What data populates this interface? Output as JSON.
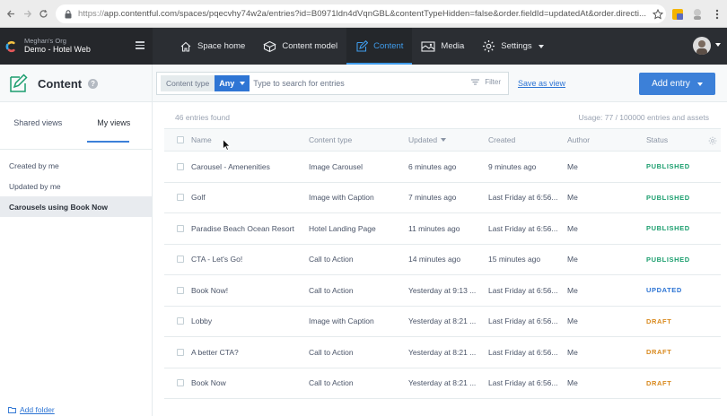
{
  "browser": {
    "url_protocol": "https://",
    "url_rest": "app.contentful.com/spaces/pqecvhy74w2a/entries?id=B0971ldn4dVqnGBL&contentTypeHidden=false&order.fieldId=updatedAt&order.directi..."
  },
  "topnav": {
    "org": "Meghan's Org",
    "space": "Demo - Hotel Web",
    "items": [
      {
        "label": "Space home",
        "icon": "home-icon"
      },
      {
        "label": "Content model",
        "icon": "cube-icon"
      },
      {
        "label": "Content",
        "icon": "edit-icon",
        "active": true
      },
      {
        "label": "Media",
        "icon": "media-icon"
      },
      {
        "label": "Settings",
        "icon": "gear-icon"
      }
    ]
  },
  "header": {
    "title": "Content",
    "content_type_label": "Content type",
    "content_type_value": "Any",
    "search_placeholder": "Type to search for entries",
    "filter_label": "Filter",
    "save_view_label": "Save as view",
    "add_entry_label": "Add entry"
  },
  "sidebar": {
    "tabs": [
      "Shared views",
      "My views"
    ],
    "active_tab": "My views",
    "items": [
      "Created by me",
      "Updated by me",
      "Carousels using Book Now"
    ],
    "active_item": "Carousels using Book Now",
    "add_folder": "Add folder"
  },
  "main": {
    "entries_found": "46 entries found",
    "usage": "Usage: 77 / 100000 entries and assets",
    "columns": [
      "Name",
      "Content type",
      "Updated",
      "Created",
      "Author",
      "Status"
    ],
    "rows": [
      {
        "name": "Carousel - Amenenities",
        "type": "Image Carousel",
        "updated": "6 minutes ago",
        "created": "9 minutes ago",
        "author": "Me",
        "status": "PUBLISHED"
      },
      {
        "name": "Golf",
        "type": "Image with Caption",
        "updated": "7 minutes ago",
        "created": "Last Friday at 6:56...",
        "author": "Me",
        "status": "PUBLISHED"
      },
      {
        "name": "Paradise Beach Ocean Resort",
        "type": "Hotel Landing Page",
        "updated": "11 minutes ago",
        "created": "Last Friday at 6:56...",
        "author": "Me",
        "status": "PUBLISHED"
      },
      {
        "name": "CTA - Let's Go!",
        "type": "Call to Action",
        "updated": "14 minutes ago",
        "created": "15 minutes ago",
        "author": "Me",
        "status": "PUBLISHED"
      },
      {
        "name": "Book Now!",
        "type": "Call to Action",
        "updated": "Yesterday at 9:13 ...",
        "created": "Last Friday at 6:56...",
        "author": "Me",
        "status": "UPDATED"
      },
      {
        "name": "Lobby",
        "type": "Image with Caption",
        "updated": "Yesterday at 8:21 ...",
        "created": "Last Friday at 6:56...",
        "author": "Me",
        "status": "DRAFT"
      },
      {
        "name": "A better CTA?",
        "type": "Call to Action",
        "updated": "Yesterday at 8:21 ...",
        "created": "Last Friday at 6:56...",
        "author": "Me",
        "status": "DRAFT"
      },
      {
        "name": "Book Now",
        "type": "Call to Action",
        "updated": "Yesterday at 8:21 ...",
        "created": "Last Friday at 6:56...",
        "author": "Me",
        "status": "DRAFT"
      }
    ]
  },
  "status_colors": {
    "PUBLISHED": "#1b9e6e",
    "UPDATED": "#2e75d4",
    "DRAFT": "#d98a1f"
  },
  "colors": {
    "accent": "#3c80d8",
    "nav_bg": "#2b2e33"
  }
}
